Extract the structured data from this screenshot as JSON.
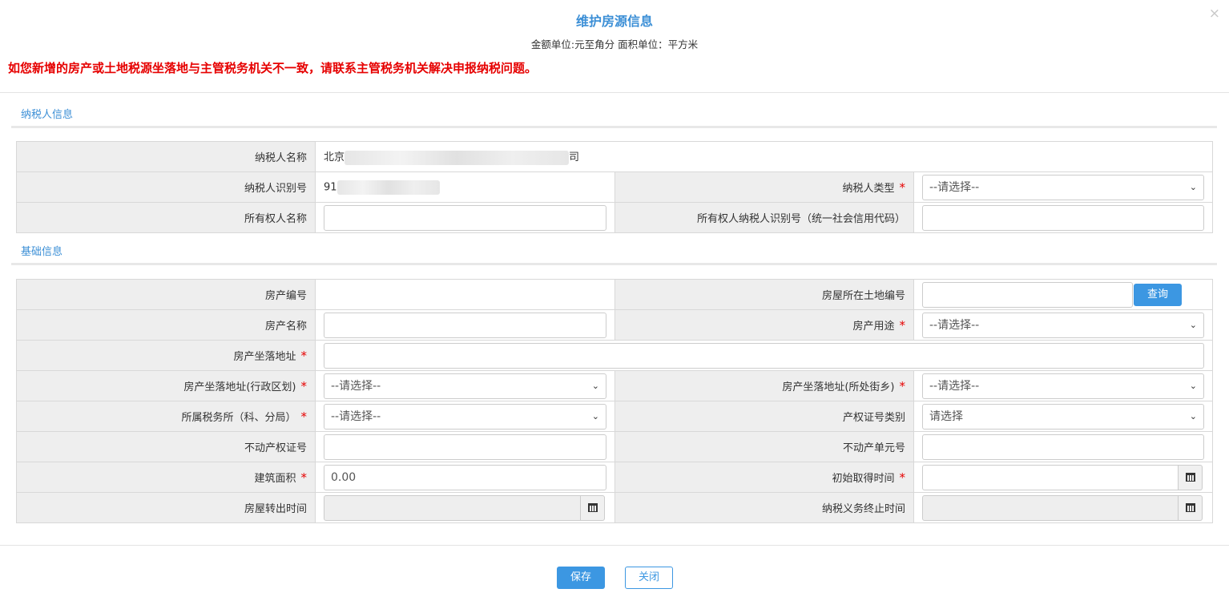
{
  "dialog": {
    "title": "维护房源信息",
    "subtitle": "金额单位:元至角分 面积单位：平方米",
    "warning": "如您新增的房产或土地税源坐落地与主管税务机关不一致，请联系主管税务机关解决申报纳税问题。",
    "close_glyph": "×"
  },
  "taxpayer_section": {
    "tab_label": "纳税人信息",
    "name_label": "纳税人名称",
    "name_value_prefix": "北京",
    "name_value_suffix": "司",
    "id_label": "纳税人识别号",
    "id_value_prefix": "91",
    "type_label": "纳税人类型",
    "type_value": "--请选择--",
    "owner_name_label": "所有权人名称",
    "owner_name_value": "",
    "owner_id_label": "所有权人纳税人识别号（统一社会信用代码）",
    "owner_id_value": ""
  },
  "basic_section": {
    "tab_label": "基础信息",
    "property_no_label": "房产编号",
    "property_no_value": "",
    "land_no_label": "房屋所在土地编号",
    "land_no_value": "",
    "query_button": "查询",
    "property_name_label": "房产名称",
    "property_name_value": "",
    "usage_label": "房产用途",
    "usage_value": "--请选择--",
    "address_label": "房产坐落地址",
    "address_value": "",
    "district_label": "房产坐落地址(行政区划)",
    "district_value": "--请选择--",
    "street_label": "房产坐落地址(所处街乡)",
    "street_value": "--请选择--",
    "tax_office_label": "所属税务所（科、分局）",
    "tax_office_value": "--请选择--",
    "cert_type_label": "产权证号类别",
    "cert_type_value": "请选择",
    "cert_no_label": "不动产权证号",
    "cert_no_value": "",
    "unit_no_label": "不动产单元号",
    "unit_no_value": "",
    "area_label": "建筑面积",
    "area_value": "0.00",
    "acquire_date_label": "初始取得时间",
    "acquire_date_value": "",
    "transfer_date_label": "房屋转出时间",
    "transfer_date_value": "",
    "end_date_label": "纳税义务终止时间",
    "end_date_value": ""
  },
  "footer": {
    "save_button": "保存",
    "close_button": "关闭"
  },
  "colors": {
    "accent": "#3c97e2",
    "title": "#3c8fd6",
    "warning": "#e60000",
    "label_bg": "#eeeeee"
  }
}
